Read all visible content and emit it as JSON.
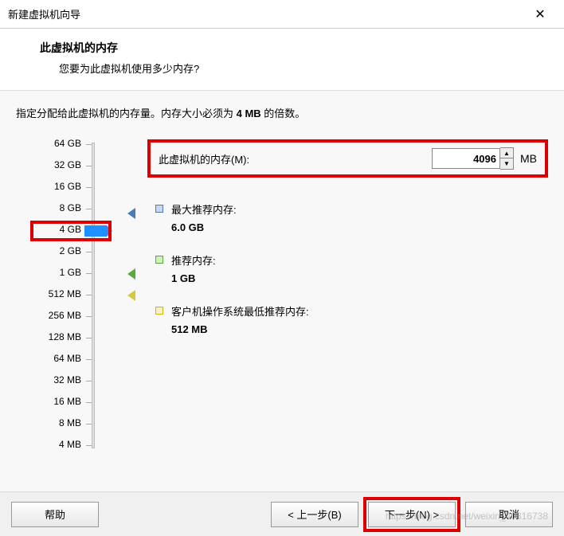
{
  "window": {
    "title": "新建虚拟机向导"
  },
  "header": {
    "title": "此虚拟机的内存",
    "subtitle": "您要为此虚拟机使用多少内存?"
  },
  "instruction": {
    "prefix": "指定分配给此虚拟机的内存量。内存大小必须为 ",
    "bold": "4 MB",
    "suffix": " 的倍数。"
  },
  "memory": {
    "label": "此虚拟机的内存(M):",
    "value": "4096",
    "unit": "MB"
  },
  "slider": {
    "labels": [
      "64 GB",
      "32 GB",
      "16 GB",
      "8 GB",
      "4 GB",
      "2 GB",
      "1 GB",
      "512 MB",
      "256 MB",
      "128 MB",
      "64 MB",
      "32 MB",
      "16 MB",
      "8 MB",
      "4 MB"
    ],
    "selected_index": 4
  },
  "recommendations": [
    {
      "icon": "blue",
      "title": "最大推荐内存:",
      "value": "6.0 GB"
    },
    {
      "icon": "green",
      "title": "推荐内存:",
      "value": "1 GB"
    },
    {
      "icon": "yellow",
      "title": "客户机操作系统最低推荐内存:",
      "value": "512 MB"
    }
  ],
  "buttons": {
    "help": "帮助",
    "back": "< 上一步(B)",
    "next": "下一步(N) >",
    "cancel": "取消"
  },
  "watermark": "https://blog.csdn.net/weixin_40816738"
}
